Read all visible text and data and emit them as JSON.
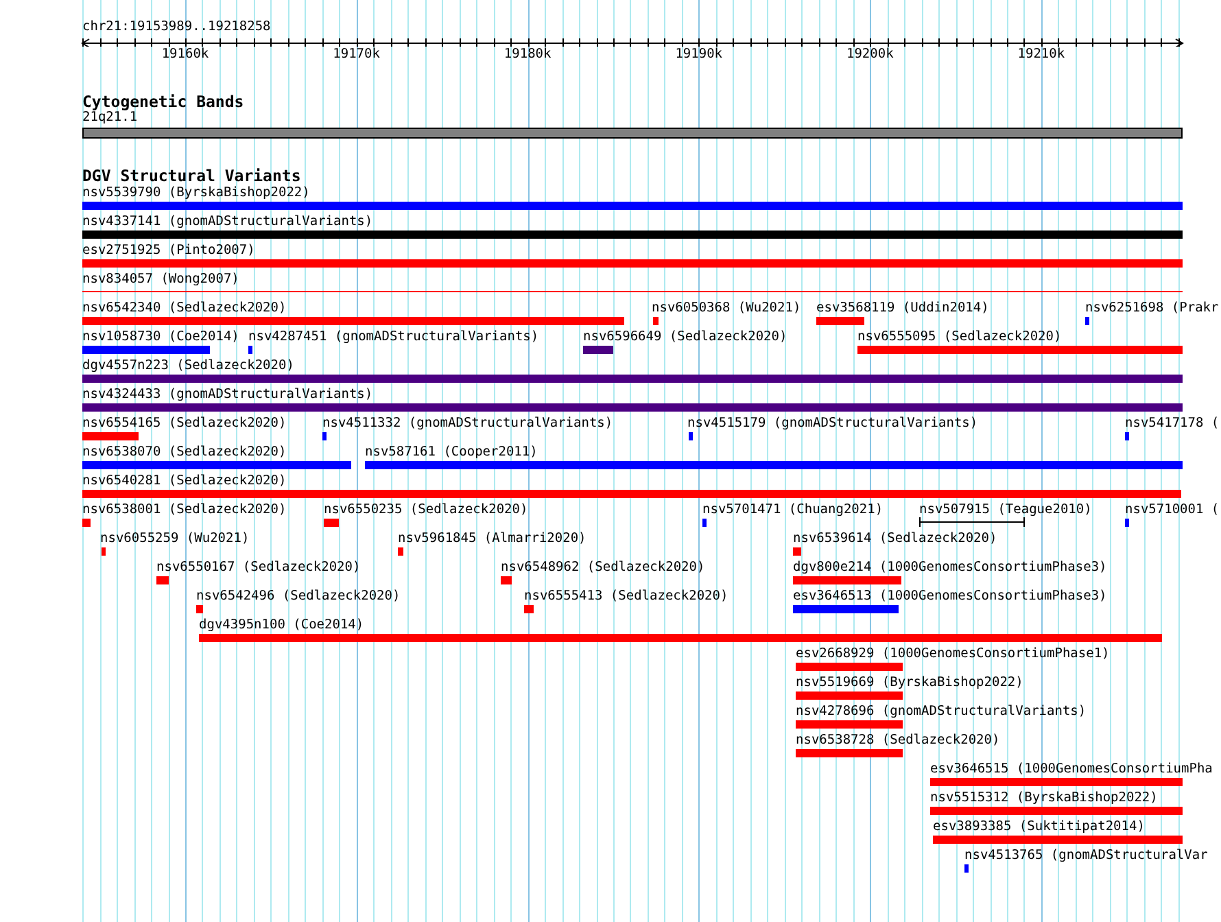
{
  "ruler": {
    "location": "chr21:19153989..19218258",
    "ticks": [
      "19160k",
      "19170k",
      "19180k",
      "19190k",
      "19200k",
      "19210k"
    ]
  },
  "cytoband_track": {
    "title": "Cytogenetic Bands",
    "band": {
      "label": "21q21.1"
    }
  },
  "variant_track": {
    "title": "DGV Structural Variants",
    "rows": [
      {
        "features": [
          {
            "label": "nsv5539790 (ByrskaBishop2022)",
            "kind": "bar",
            "color": "#0000ff"
          }
        ]
      },
      {
        "features": [
          {
            "label": "nsv4337141 (gnomADStructuralVariants)",
            "kind": "bar",
            "color": "#000000"
          }
        ]
      },
      {
        "features": [
          {
            "label": "esv2751925 (Pinto2007)",
            "kind": "bar",
            "color": "#ff0000"
          }
        ]
      },
      {
        "features": [
          {
            "label": "nsv834057 (Wong2007)",
            "kind": "line",
            "color": "#ff0000"
          }
        ]
      },
      {
        "features": [
          {
            "label": "nsv6542340 (Sedlazeck2020)",
            "kind": "bar",
            "color": "#ff0000"
          },
          {
            "label": "nsv6050368 (Wu2021)",
            "kind": "bar",
            "color": "#ff0000"
          },
          {
            "label": "esv3568119 (Uddin2014)",
            "kind": "bar",
            "color": "#ff0000"
          },
          {
            "label": "nsv6251698 (Prakr",
            "kind": "bar",
            "color": "#0000ff"
          }
        ]
      },
      {
        "features": [
          {
            "label": "nsv1058730 (Coe2014)",
            "kind": "bar",
            "color": "#0000ff"
          },
          {
            "label": "nsv4287451 (gnomADStructuralVariants)",
            "kind": "bar",
            "color": "#0000ff"
          },
          {
            "label": "nsv6596649 (Sedlazeck2020)",
            "kind": "bar",
            "color": "#4b0082"
          },
          {
            "label": "nsv6555095 (Sedlazeck2020)",
            "kind": "bar",
            "color": "#ff0000"
          }
        ]
      },
      {
        "features": [
          {
            "label": "dgv4557n223 (Sedlazeck2020)",
            "kind": "bar",
            "color": "#4b0082"
          }
        ]
      },
      {
        "features": [
          {
            "label": "nsv4324433 (gnomADStructuralVariants)",
            "kind": "bar",
            "color": "#4b0082"
          }
        ]
      },
      {
        "features": [
          {
            "label": "nsv6554165 (Sedlazeck2020)",
            "kind": "bar",
            "color": "#ff0000"
          },
          {
            "label": "nsv4511332 (gnomADStructuralVariants)",
            "kind": "bar",
            "color": "#0000ff"
          },
          {
            "label": "nsv4515179 (gnomADStructuralVariants)",
            "kind": "bar",
            "color": "#0000ff"
          },
          {
            "label": "nsv5417178 (",
            "kind": "bar",
            "color": "#0000ff"
          }
        ]
      },
      {
        "features": [
          {
            "label": "nsv6538070 (Sedlazeck2020)",
            "kind": "bar",
            "color": "#0000ff"
          },
          {
            "label": "nsv587161 (Cooper2011)",
            "kind": "bar",
            "color": "#0000ff"
          }
        ]
      },
      {
        "features": [
          {
            "label": "nsv6540281 (Sedlazeck2020)",
            "kind": "bar",
            "color": "#ff0000"
          }
        ]
      },
      {
        "features": [
          {
            "label": "nsv6538001 (Sedlazeck2020)",
            "kind": "bar",
            "color": "#ff0000"
          },
          {
            "label": "nsv6550235 (Sedlazeck2020)",
            "kind": "bar",
            "color": "#ff0000"
          },
          {
            "label": "nsv5701471 (Chuang2021)",
            "kind": "bar",
            "color": "#0000ff"
          },
          {
            "label": "nsv507915 (Teague2010)",
            "kind": "interval",
            "color": "#000000"
          },
          {
            "label": "nsv5710001 (",
            "kind": "bar",
            "color": "#0000ff"
          }
        ]
      },
      {
        "features": [
          {
            "label": "nsv6055259 (Wu2021)",
            "kind": "bar",
            "color": "#ff0000"
          },
          {
            "label": "nsv5961845 (Almarri2020)",
            "kind": "bar",
            "color": "#ff0000"
          },
          {
            "label": "nsv6539614 (Sedlazeck2020)",
            "kind": "bar",
            "color": "#ff0000"
          }
        ]
      },
      {
        "features": [
          {
            "label": "nsv6550167 (Sedlazeck2020)",
            "kind": "bar",
            "color": "#ff0000"
          },
          {
            "label": "nsv6548962 (Sedlazeck2020)",
            "kind": "bar",
            "color": "#ff0000"
          },
          {
            "label": "dgv800e214 (1000GenomesConsortiumPhase3)",
            "kind": "bar",
            "color": "#ff0000"
          }
        ]
      },
      {
        "features": [
          {
            "label": "nsv6542496 (Sedlazeck2020)",
            "kind": "bar",
            "color": "#ff0000"
          },
          {
            "label": "nsv6555413 (Sedlazeck2020)",
            "kind": "bar",
            "color": "#ff0000"
          },
          {
            "label": "esv3646513 (1000GenomesConsortiumPhase3)",
            "kind": "bar",
            "color": "#0000ff"
          }
        ]
      },
      {
        "features": [
          {
            "label": "dgv4395n100 (Coe2014)",
            "kind": "bar",
            "color": "#ff0000"
          }
        ]
      },
      {
        "features": [
          {
            "label": "esv2668929 (1000GenomesConsortiumPhase1)",
            "kind": "bar",
            "color": "#ff0000"
          }
        ]
      },
      {
        "features": [
          {
            "label": "nsv5519669 (ByrskaBishop2022)",
            "kind": "bar",
            "color": "#ff0000"
          }
        ]
      },
      {
        "features": [
          {
            "label": "nsv4278696 (gnomADStructuralVariants)",
            "kind": "bar",
            "color": "#ff0000"
          }
        ]
      },
      {
        "features": [
          {
            "label": "nsv6538728 (Sedlazeck2020)",
            "kind": "bar",
            "color": "#ff0000"
          }
        ]
      },
      {
        "features": [
          {
            "label": "esv3646515 (1000GenomesConsortiumPha",
            "kind": "bar",
            "color": "#ff0000"
          }
        ]
      },
      {
        "features": [
          {
            "label": "nsv5515312 (ByrskaBishop2022)",
            "kind": "bar",
            "color": "#ff0000"
          }
        ]
      },
      {
        "features": [
          {
            "label": "esv3893385 (Suktitipat2014)",
            "kind": "bar",
            "color": "#ff0000"
          }
        ]
      },
      {
        "features": [
          {
            "label": "nsv4513765 (gnomADStructuralVar",
            "kind": "bar",
            "color": "#0000ff"
          }
        ]
      }
    ]
  }
}
